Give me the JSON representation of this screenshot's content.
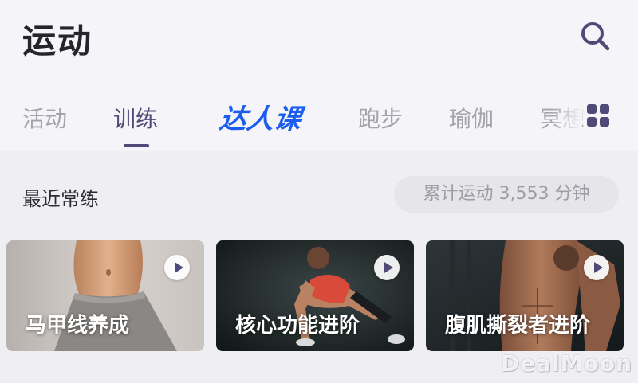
{
  "header": {
    "title": "运动"
  },
  "tabs": [
    {
      "label": "活动",
      "state": "normal"
    },
    {
      "label": "训练",
      "state": "active"
    },
    {
      "label": "达人课",
      "state": "special"
    },
    {
      "label": "跑步",
      "state": "normal"
    },
    {
      "label": "瑜伽",
      "state": "normal"
    },
    {
      "label": "冥想",
      "state": "partially-hidden"
    }
  ],
  "icons": {
    "search": "search-icon",
    "more_tabs": "grid-icon",
    "play": "play-icon"
  },
  "recent": {
    "title": "最近常练",
    "stat": "累计运动 3,553 分钟",
    "cards": [
      {
        "label": "马甲线养成"
      },
      {
        "label": "核心功能进阶"
      },
      {
        "label": "腹肌撕裂者进阶"
      }
    ]
  },
  "watermark": "DealMoon",
  "colors": {
    "accent": "#4f4a77",
    "special_tab": "#1b5df0",
    "inactive_tab": "#a4a3ab"
  }
}
